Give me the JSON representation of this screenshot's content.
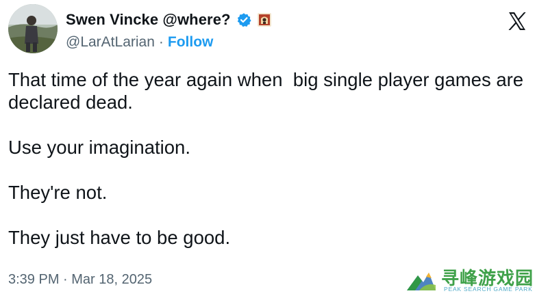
{
  "author": {
    "display_name": "Swen Vincke @where?",
    "handle": "@LarAtLarian",
    "separator": "·",
    "follow_label": "Follow",
    "verified": true
  },
  "tweet": {
    "paragraphs": [
      "That time of the year again when  big single player games are declared dead.",
      "Use your imagination.",
      "They're not.",
      "They just have to be good."
    ],
    "timestamp": "3:39 PM · Mar 18, 2025"
  },
  "icons": {
    "platform_logo": "x-logo-icon",
    "verified_badge": "verified-badge-icon",
    "profile_flag": "profile-emoji-icon"
  },
  "colors": {
    "link": "#1d9bf0",
    "secondary_text": "#536471",
    "primary_text": "#0f1419",
    "watermark_green": "#2f9a3a"
  },
  "watermark": {
    "title": "寻峰游戏园",
    "subtitle": "PEAK SEARCH GAME PARK"
  }
}
